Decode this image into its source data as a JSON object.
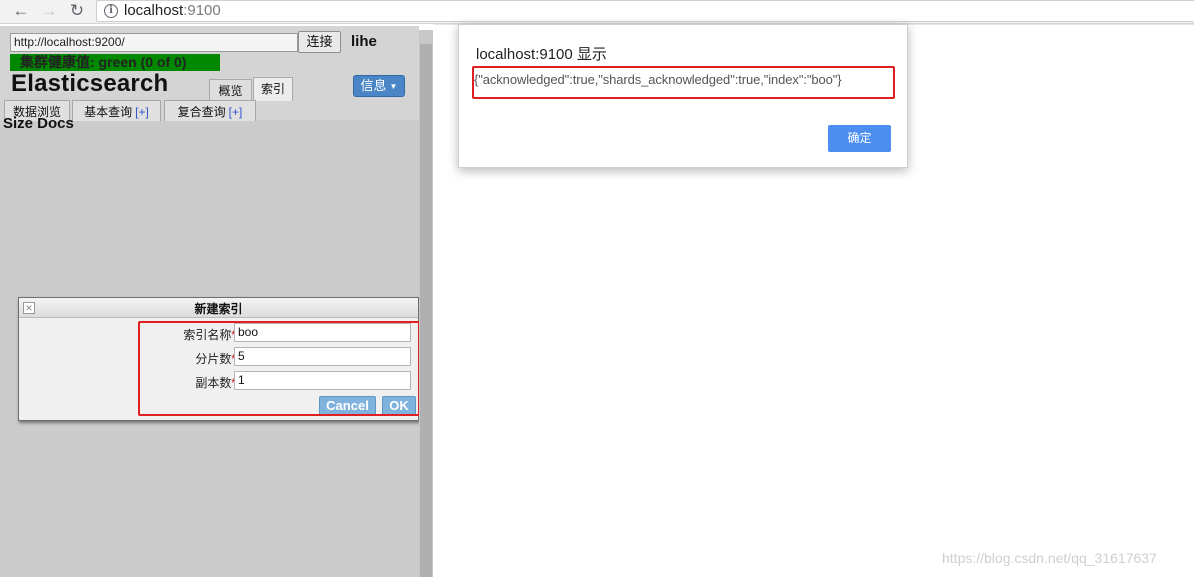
{
  "browser": {
    "url_host": "localhost",
    "url_port": ":9100"
  },
  "app": {
    "connection_url": "http://localhost:9200/",
    "connect_label": "连接",
    "cluster_name": "lihe",
    "health_status": "集群健康值: green (0 of 0)",
    "title": "Elasticsearch",
    "tabs": [
      {
        "label": "概览"
      },
      {
        "label": "索引"
      }
    ],
    "info_label": "信息",
    "subtabs": [
      {
        "label": "数据浏览",
        "plus": ""
      },
      {
        "label": "基本查询",
        "plus": "[+]"
      },
      {
        "label": "复合查询",
        "plus": "[+]"
      }
    ],
    "size_docs_label": "Size Docs"
  },
  "dialog": {
    "title": "新建索引",
    "fields": [
      {
        "label": "索引名称",
        "required_mark": "*",
        "value": "boo"
      },
      {
        "label": "分片数",
        "required_mark": "*",
        "value": "5"
      },
      {
        "label": "副本数",
        "required_mark": "*",
        "value": "1"
      }
    ],
    "cancel_label": "Cancel",
    "ok_label": "OK"
  },
  "alert": {
    "title": "localhost:9100 显示",
    "message": "{\"acknowledged\":true,\"shards_acknowledged\":true,\"index\":\"boo\"}",
    "confirm_label": "确定"
  },
  "watermark": "https://blog.csdn.net/qq_31617637"
}
